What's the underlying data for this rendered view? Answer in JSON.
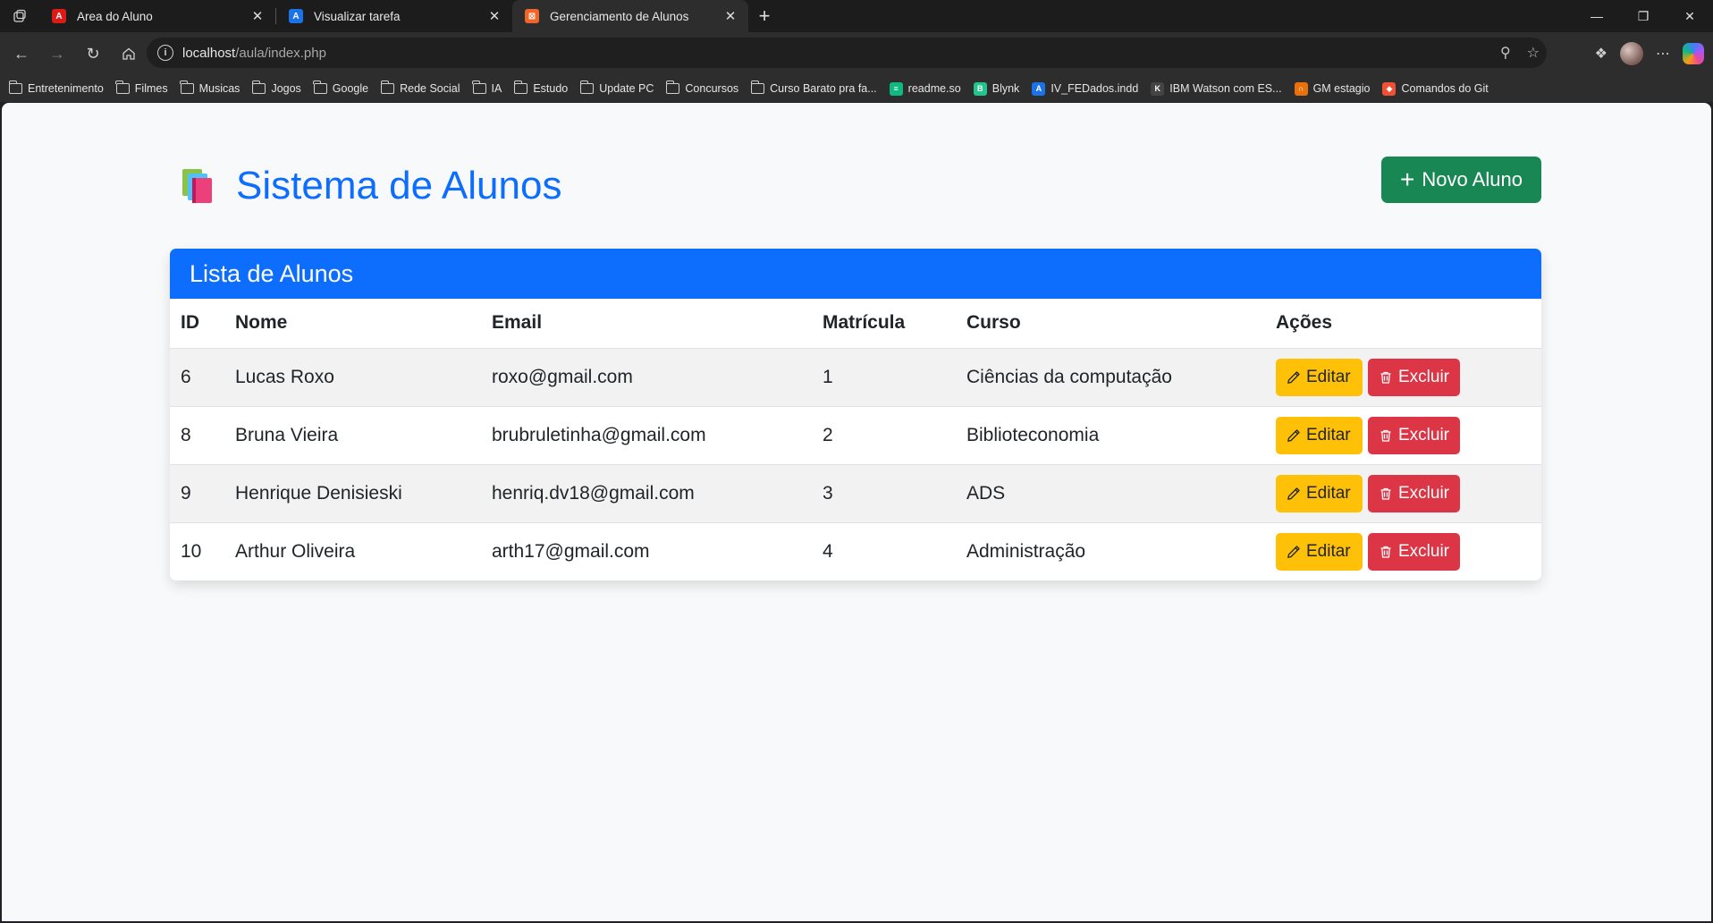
{
  "browser": {
    "tabs": [
      {
        "title": "Area do Aluno",
        "favicon_color": "#dd1b16",
        "favicon_glyph": "A",
        "active": false
      },
      {
        "title": "Visualizar tarefa",
        "favicon_color": "#1a73e8",
        "favicon_glyph": "A",
        "active": false
      },
      {
        "title": "Gerenciamento de Alunos",
        "favicon_color": "#f06529",
        "favicon_glyph": "⊠",
        "active": true
      }
    ],
    "url_host": "localhost",
    "url_path": "/aula/index.php",
    "bookmarks": [
      {
        "label": "Entretenimento",
        "type": "folder"
      },
      {
        "label": "Filmes",
        "type": "folder"
      },
      {
        "label": "Musicas",
        "type": "folder"
      },
      {
        "label": "Jogos",
        "type": "folder"
      },
      {
        "label": "Google",
        "type": "folder"
      },
      {
        "label": "Rede Social",
        "type": "folder"
      },
      {
        "label": "IA",
        "type": "folder"
      },
      {
        "label": "Estudo",
        "type": "folder"
      },
      {
        "label": "Update PC",
        "type": "folder"
      },
      {
        "label": "Concursos",
        "type": "folder"
      },
      {
        "label": "Curso Barato pra fa...",
        "type": "folder"
      },
      {
        "label": "readme.so",
        "type": "site",
        "color": "#10b981",
        "glyph": "≡"
      },
      {
        "label": "Blynk",
        "type": "site",
        "color": "#23c48e",
        "glyph": "B"
      },
      {
        "label": "IV_FEDados.indd",
        "type": "site",
        "color": "#1a73e8",
        "glyph": "A"
      },
      {
        "label": "IBM Watson com ES...",
        "type": "site",
        "color": "#444444",
        "glyph": "K"
      },
      {
        "label": "GM estagio",
        "type": "site",
        "color": "#e8710a",
        "glyph": "∩"
      },
      {
        "label": "Comandos do Git",
        "type": "site",
        "color": "#f05033",
        "glyph": "◆"
      }
    ]
  },
  "page": {
    "title": "Sistema de Alunos",
    "new_button_label": "Novo Aluno",
    "card_title": "Lista de Alunos",
    "columns": [
      "ID",
      "Nome",
      "Email",
      "Matrícula",
      "Curso",
      "Ações"
    ],
    "rows": [
      {
        "id": "6",
        "nome": "Lucas Roxo",
        "email": "roxo@gmail.com",
        "matricula": "1",
        "curso": "Ciências da computação"
      },
      {
        "id": "8",
        "nome": "Bruna Vieira",
        "email": "brubruletinha@gmail.com",
        "matricula": "2",
        "curso": "Biblioteconomia"
      },
      {
        "id": "9",
        "nome": "Henrique Denisieski",
        "email": "henriq.dv18@gmail.com",
        "matricula": "3",
        "curso": "ADS"
      },
      {
        "id": "10",
        "nome": "Arthur Oliveira",
        "email": "arth17@gmail.com",
        "matricula": "4",
        "curso": "Administração"
      }
    ],
    "edit_label": "Editar",
    "delete_label": "Excluir"
  },
  "colors": {
    "primary": "#0d6efd",
    "success": "#198754",
    "warning": "#ffc107",
    "danger": "#dc3545"
  }
}
